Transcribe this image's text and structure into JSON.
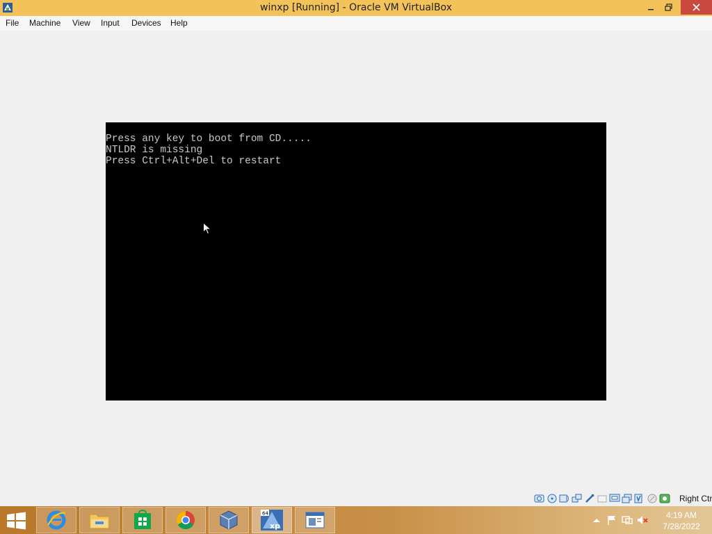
{
  "window": {
    "title": "winxp  [Running] - Oracle VM VirtualBox",
    "accent": "#f3c35a",
    "close_color": "#c9493f"
  },
  "menu": [
    "File",
    "Machine",
    "View",
    "Input",
    "Devices",
    "Help"
  ],
  "vm_console": {
    "lines": [
      "Press any key to boot from CD.....",
      "NTLDR is missing",
      "Press Ctrl+Alt+Del to restart"
    ],
    "background": "#000000",
    "text_color": "#c8c8c8"
  },
  "status_bar": {
    "icons": [
      "hard-disk-icon",
      "optical-drive-icon",
      "audio-icon",
      "network-icon",
      "usb-icon",
      "shared-folders-icon",
      "display-icon",
      "video-capture-icon",
      "cpu-icon",
      "mouse-integration-icon",
      "keyboard-capture-icon"
    ],
    "host_key": "Right Ctrl"
  },
  "taskbar": {
    "pinned": [
      {
        "name": "internet-explorer",
        "icon": "ie-icon"
      },
      {
        "name": "file-explorer",
        "icon": "folder-icon"
      },
      {
        "name": "store",
        "icon": "store-icon"
      },
      {
        "name": "chrome",
        "icon": "chrome-icon"
      },
      {
        "name": "virtualbox",
        "icon": "virtualbox-icon"
      },
      {
        "name": "winxp-vm",
        "icon": "vm-xp-icon"
      },
      {
        "name": "screen-app",
        "icon": "window-icon"
      }
    ],
    "tray_icons": [
      "show-hidden-icons-icon",
      "action-center-flag-icon",
      "network-icon",
      "volume-muted-icon"
    ],
    "clock": {
      "time": "4:19 AM",
      "date": "7/28/2022"
    }
  }
}
